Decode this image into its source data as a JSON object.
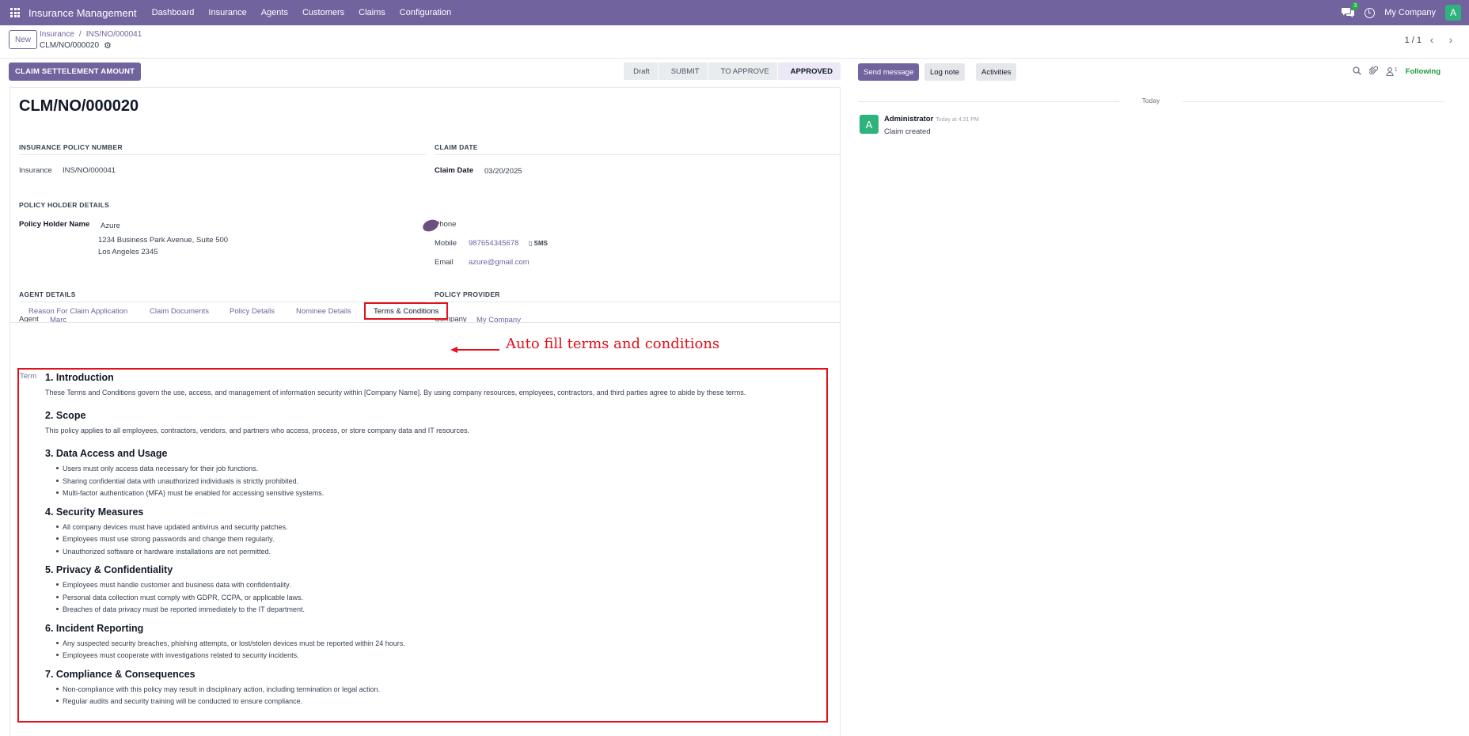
{
  "navbar": {
    "app_name": "Insurance Management",
    "menu": [
      "Dashboard",
      "Insurance",
      "Agents",
      "Customers",
      "Claims",
      "Configuration"
    ],
    "chat_count": "3",
    "company": "My Company",
    "user_initial": "A",
    "accent_color": "#71639e"
  },
  "control": {
    "new_label": "New",
    "breadcrumb": [
      "Insurance",
      "INS/NO/000041"
    ],
    "record_name": "CLM/NO/000020",
    "pager": "1 / 1"
  },
  "header": {
    "action_button": "CLAIM SETTELEMENT AMOUNT",
    "stages": [
      "Draft",
      "SUBMIT",
      "TO APPROVE",
      "APPROVED"
    ],
    "active_stage": "APPROVED"
  },
  "form": {
    "title": "CLM/NO/000020",
    "policy_section": "INSURANCE POLICY NUMBER",
    "insurance_label": "Insurance",
    "insurance_value": "INS/NO/000041",
    "claim_section": "CLAIM DATE",
    "claim_date_label": "Claim Date",
    "claim_date_value": "03/20/2025",
    "holder_section": "POLICY HOLDER DETAILS",
    "holder_name_label": "Policy Holder Name",
    "holder_name": "Azure",
    "holder_address_1": "1234 Business Park Avenue, Suite 500",
    "holder_address_2": "Los Angeles 2345",
    "phone_label": "Phone",
    "mobile_label": "Mobile",
    "mobile_value": "987654345678",
    "sms_label": "SMS",
    "email_label": "Email",
    "email_value": "azure@gmail.com",
    "agent_section": "AGENT DETAILS",
    "agent_label": "Agent",
    "agent_value": "Marc",
    "provider_section": "POLICY PROVIDER",
    "company_label": "Company",
    "company_value": "My Company"
  },
  "tabs": [
    "Reason For Claim Application",
    "Claim Documents",
    "Policy Details",
    "Nominee Details",
    "Terms & Conditions"
  ],
  "active_tab": "Terms & Conditions",
  "annotation": {
    "text": "Auto fill terms and conditions",
    "color": "#e3111b"
  },
  "terms": {
    "label": "Term",
    "sections": [
      {
        "title": "1. Introduction",
        "text": "These Terms and Conditions govern the use, access, and management of information security within [Company Name]. By using company resources, employees, contractors, and third parties agree to abide by these terms."
      },
      {
        "title": "2. Scope",
        "text": "This policy applies to all employees, contractors, vendors, and partners who access, process, or store company data and IT resources."
      },
      {
        "title": "3. Data Access and Usage",
        "items": [
          "Users must only access data necessary for their job functions.",
          "Sharing confidential data with unauthorized individuals is strictly prohibited.",
          "Multi-factor authentication (MFA) must be enabled for accessing sensitive systems."
        ]
      },
      {
        "title": "4. Security Measures",
        "items": [
          "All company devices must have updated antivirus and security patches.",
          "Employees must use strong passwords and change them regularly.",
          "Unauthorized software or hardware installations are not permitted."
        ]
      },
      {
        "title": "5. Privacy & Confidentiality",
        "items": [
          "Employees must handle customer and business data with confidentiality.",
          "Personal data collection must comply with GDPR, CCPA, or applicable laws.",
          "Breaches of data privacy must be reported immediately to the IT department."
        ]
      },
      {
        "title": "6. Incident Reporting",
        "items": [
          "Any suspected security breaches, phishing attempts, or lost/stolen devices must be reported within 24 hours.",
          "Employees must cooperate with investigations related to security incidents."
        ]
      },
      {
        "title": "7. Compliance & Consequences",
        "items": [
          "Non-compliance with this policy may result in disciplinary action, including termination or legal action.",
          "Regular audits and security training will be conducted to ensure compliance."
        ]
      }
    ]
  },
  "chatter": {
    "send_message": "Send message",
    "log_note": "Log note",
    "activities": "Activities",
    "followers_count": "1",
    "following": "Following",
    "date_separator": "Today",
    "message": {
      "avatar_initial": "A",
      "author": "Administrator",
      "time": "Today at 4:31 PM",
      "body": "Claim created"
    }
  }
}
